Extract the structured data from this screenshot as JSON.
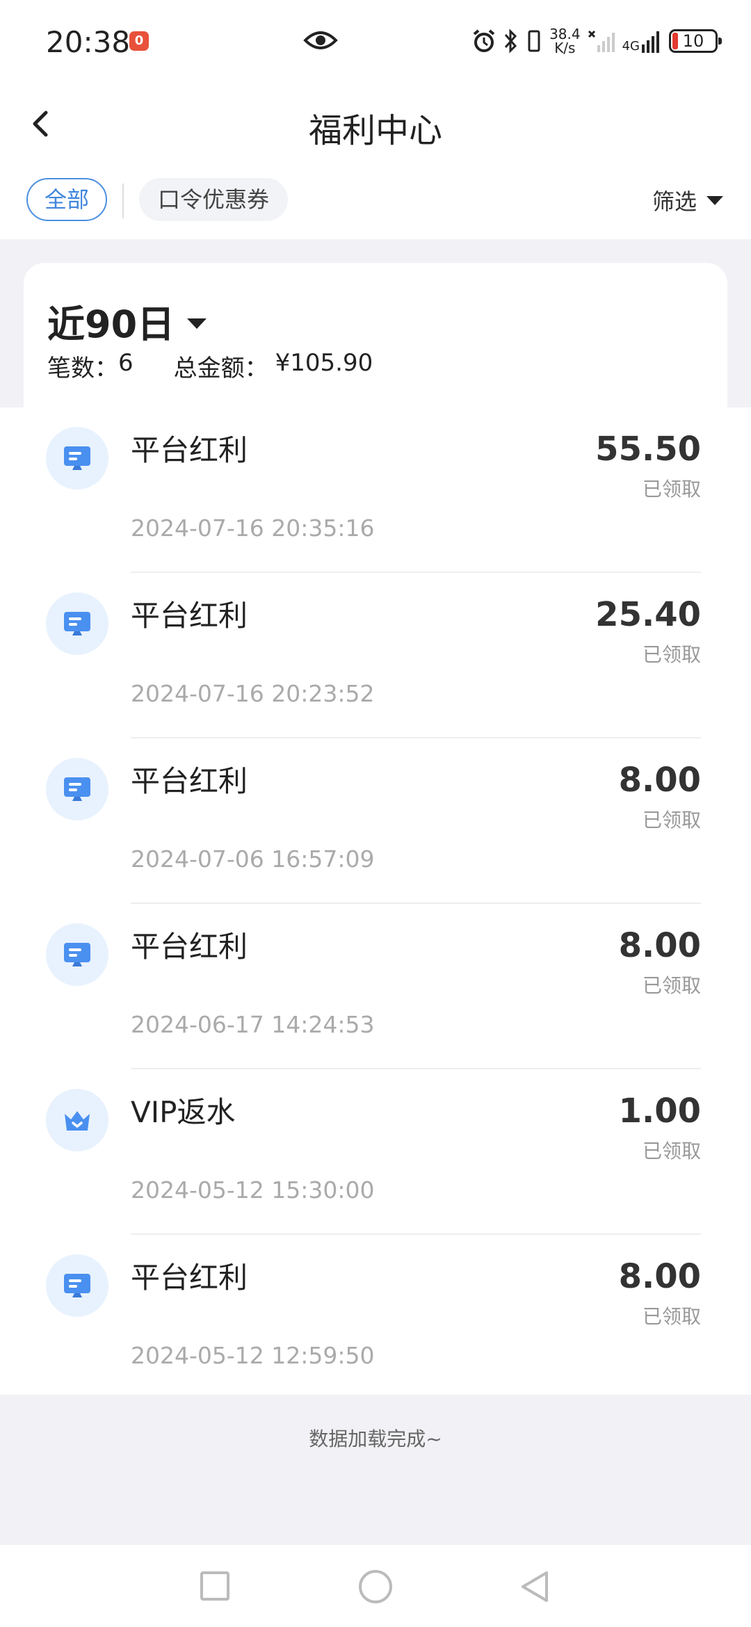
{
  "status_bar": {
    "time": "20:38",
    "notification_badge": "0",
    "net_speed_value": "38.4",
    "net_speed_unit": "K/s",
    "network_type": "4G",
    "battery": "10"
  },
  "header": {
    "title": "福利中心"
  },
  "filters": {
    "all_label": "全部",
    "coupon_label": "口令优惠券",
    "filter_label": "筛选"
  },
  "summary": {
    "period_label": "近90日",
    "count_label": "笔数：",
    "count_value": "6",
    "total_label": "总金额：",
    "total_value": "¥105.90"
  },
  "records": [
    {
      "title": "平台红利",
      "amount": "55.50",
      "status": "已领取",
      "time": "2024-07-16 20:35:16",
      "icon": "monitor-icon"
    },
    {
      "title": "平台红利",
      "amount": "25.40",
      "status": "已领取",
      "time": "2024-07-16 20:23:52",
      "icon": "monitor-icon"
    },
    {
      "title": "平台红利",
      "amount": "8.00",
      "status": "已领取",
      "time": "2024-07-06 16:57:09",
      "icon": "monitor-icon"
    },
    {
      "title": "平台红利",
      "amount": "8.00",
      "status": "已领取",
      "time": "2024-06-17 14:24:53",
      "icon": "monitor-icon"
    },
    {
      "title": "VIP返水",
      "amount": "1.00",
      "status": "已领取",
      "time": "2024-05-12 15:30:00",
      "icon": "crown-icon"
    },
    {
      "title": "平台红利",
      "amount": "8.00",
      "status": "已领取",
      "time": "2024-05-12 12:59:50",
      "icon": "monitor-icon"
    }
  ],
  "footer": {
    "load_complete": "数据加载完成~"
  },
  "colors": {
    "accent": "#3f86dc",
    "icon_bg": "#e8f2fe",
    "icon_fg": "#4a90f0",
    "page_bg": "#f2f2f6"
  }
}
